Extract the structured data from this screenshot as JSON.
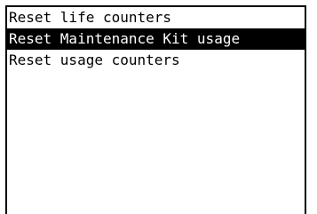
{
  "menu": {
    "items": [
      {
        "label": "Reset life counters",
        "selected": false
      },
      {
        "label": "Reset Maintenance Kit usage",
        "selected": true
      },
      {
        "label": "Reset usage counters",
        "selected": false
      }
    ]
  },
  "colors": {
    "foreground": "#000000",
    "background": "#ffffff",
    "highlight_bg": "#000000",
    "highlight_fg": "#ffffff"
  }
}
